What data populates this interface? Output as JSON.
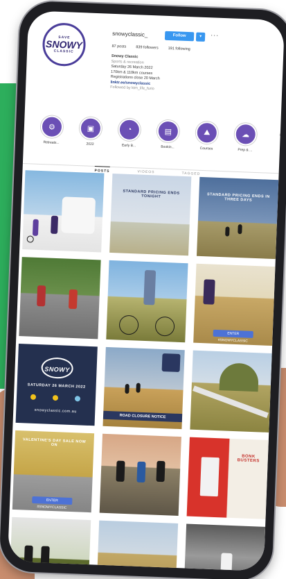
{
  "profile": {
    "logo_small": "SAVE",
    "logo_big": "SNOWY",
    "logo_sub": "CLASSIC",
    "username": "snowyclassic_",
    "follow_label": "Follow",
    "more_label": "···",
    "stats": [
      "87 posts",
      "839 followers",
      "191 following"
    ],
    "bio_name": "Snowy Classic",
    "bio_category": "Sports & recreation",
    "bio_lines": [
      "Saturday 26 March 2022",
      "170km & 110km courses",
      "Registrations close 20 March"
    ],
    "bio_link": "linktr.ee/snowyclassic",
    "bio_followed": "Followed by ktm_life_furio"
  },
  "highlights": [
    {
      "label": "Retreats..."
    },
    {
      "label": "2022"
    },
    {
      "label": "Early B..."
    },
    {
      "label": "Bookin..."
    },
    {
      "label": "Courses"
    },
    {
      "label": "Prep & ..."
    }
  ],
  "tabs": [
    "POSTS",
    "VIDEOS",
    "TAGGED"
  ],
  "tiles": [
    {
      "type": "photo"
    },
    {
      "type": "text",
      "caption": "STANDARD PRICING ENDS TONIGHT"
    },
    {
      "type": "text",
      "caption": "STANDARD PRICING ENDS IN THREE DAYS"
    },
    {
      "type": "photo"
    },
    {
      "type": "photo"
    },
    {
      "type": "photo",
      "button": "ENTER #SNOWYCLASSIC"
    },
    {
      "type": "promo",
      "title": "SNOWY",
      "date": "SATURDAY 26 MARCH 2022",
      "site": "snowyclassic.com.au"
    },
    {
      "type": "photo",
      "bar": "ROAD CLOSURE NOTICE"
    },
    {
      "type": "photo"
    },
    {
      "type": "photo",
      "caption": "VALENTINE'S DAY SALE NOW ON",
      "button": "ENTER #SNOWYCLASSIC"
    },
    {
      "type": "photo"
    },
    {
      "type": "product",
      "caption": "BONK BUSTERS"
    },
    {
      "type": "photo"
    },
    {
      "type": "photo"
    },
    {
      "type": "photo"
    }
  ],
  "colors": {
    "accent": "#3897f0",
    "brand": "#4a3d9a",
    "highlight": "#6b4fb5",
    "navy": "#2a3760"
  }
}
